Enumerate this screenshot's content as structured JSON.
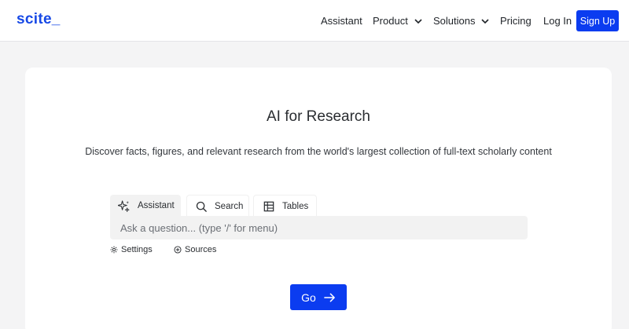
{
  "header": {
    "logo": "scite_",
    "nav": {
      "assistant": "Assistant",
      "product": "Product",
      "solutions": "Solutions",
      "pricing": "Pricing",
      "login": "Log In",
      "signup": "Sign Up"
    }
  },
  "main": {
    "title": "AI for Research",
    "subtitle": "Discover facts, figures, and relevant research from the world's largest collection of full-text scholarly content",
    "tabs": {
      "assistant": "Assistant",
      "search": "Search",
      "tables": "Tables"
    },
    "input": {
      "placeholder": "Ask a question... (type '/' for menu)",
      "value": ""
    },
    "options": {
      "settings": "Settings",
      "sources": "Sources"
    },
    "go_label": "Go"
  },
  "colors": {
    "brand": "#1749e6",
    "button": "#0b3cf0",
    "background": "#f4f4f5"
  },
  "icons": {
    "sparkle": "sparkle-icon",
    "search": "search-icon",
    "table": "table-icon",
    "gear": "gear-icon",
    "plus": "plus-circle-icon",
    "arrow": "arrow-right-icon",
    "chevron": "chevron-down-icon"
  }
}
